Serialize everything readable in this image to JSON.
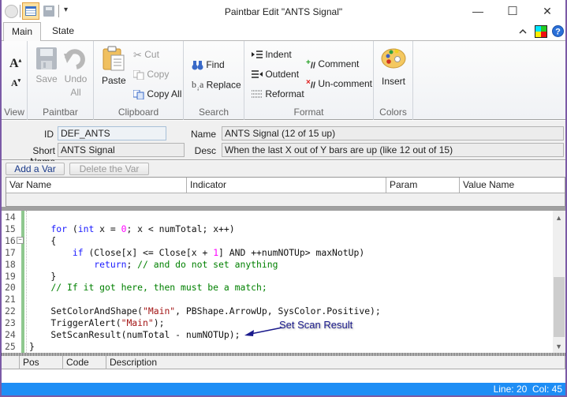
{
  "window": {
    "title": "Paintbar Edit \"ANTS Signal\"",
    "controls": {
      "minimize": "—",
      "maximize": "☐",
      "close": "✕"
    },
    "qat_dropdown": "▾"
  },
  "tabs": [
    {
      "label": "Main",
      "active": true
    },
    {
      "label": "State",
      "active": false
    }
  ],
  "ribbon": {
    "groups": [
      {
        "label": "View",
        "items": [
          {
            "label": "A",
            "icon": "font-increase-icon"
          },
          {
            "label": "A",
            "icon": "font-decrease-icon"
          }
        ]
      },
      {
        "label": "Paintbar",
        "items": [
          {
            "label": "Save",
            "enabled": false
          },
          {
            "label": "Undo All",
            "line1": "Undo",
            "line2": "All",
            "enabled": false
          }
        ]
      },
      {
        "label": "Clipboard",
        "items": [
          {
            "label": "Paste",
            "enabled": true
          },
          {
            "label": "Cut",
            "enabled": false
          },
          {
            "label": "Copy",
            "enabled": false
          },
          {
            "label": "Copy All",
            "enabled": true
          }
        ]
      },
      {
        "label": "Search",
        "items": [
          {
            "label": "Find"
          },
          {
            "label": "Replace"
          }
        ]
      },
      {
        "label": "Format",
        "items": [
          {
            "label": "Indent"
          },
          {
            "label": "Outdent"
          },
          {
            "label": "Reformat"
          },
          {
            "label": "Comment"
          },
          {
            "label": "Un-comment"
          }
        ]
      },
      {
        "label": "Colors",
        "items": [
          {
            "label": "Insert"
          }
        ]
      }
    ]
  },
  "props": {
    "id_label": "ID",
    "id_value": "DEF_ANTS",
    "shortname_label": "Short Name",
    "shortname_value": "ANTS Signal",
    "name_label": "Name",
    "name_value": "ANTS Signal (12 of 15 up)",
    "desc_label": "Desc",
    "desc_value": "When the last X out of Y bars are up (like 12 out of 15)"
  },
  "vars": {
    "add_label": "Add a Var",
    "delete_label": "Delete the Var",
    "columns": [
      "Var Name",
      "Indicator",
      "Param",
      "Value Name"
    ]
  },
  "editor": {
    "lines": [
      {
        "n": "14",
        "html": ""
      },
      {
        "n": "15",
        "html": "    <span class=\"kw\">for</span> (<span class=\"kw\">int</span> x = <span class=\"num\">0</span>; x &lt; numTotal; x++)"
      },
      {
        "n": "16",
        "html": "    {"
      },
      {
        "n": "17",
        "html": "        <span class=\"kw\">if</span> (Close[x] &lt;= Close[x + <span class=\"num\">1</span>] AND ++numNOTUp&gt; maxNotUp)"
      },
      {
        "n": "18",
        "html": "            <span class=\"kw\">return</span>; <span class=\"cmt\">// and do not set anything</span>"
      },
      {
        "n": "19",
        "html": "    }"
      },
      {
        "n": "20",
        "html": "    <span class=\"cmt\">// If it got here, then must be a match;</span>"
      },
      {
        "n": "21",
        "html": ""
      },
      {
        "n": "22",
        "html": "    SetColorAndShape(<span class=\"str\">\"Main\"</span>, PBShape.ArrowUp, SysColor.Positive);"
      },
      {
        "n": "23",
        "html": "    TriggerAlert(<span class=\"str\">\"Main\"</span>);"
      },
      {
        "n": "24",
        "html": "    SetScanResult(numTotal - numNOTUp);"
      },
      {
        "n": "25",
        "html": "}"
      }
    ],
    "annotation": "Set Scan Result"
  },
  "errors": {
    "columns": [
      "Pos",
      "Code",
      "Description"
    ]
  },
  "status": {
    "position": "Line: 20  Col: 45"
  },
  "colors": {
    "status_bar": "#1e8ef5",
    "window_border": "#7b5aa6",
    "keyword": "#1a1aff",
    "number": "#ff00ff",
    "string": "#a31515",
    "comment": "#008000"
  }
}
